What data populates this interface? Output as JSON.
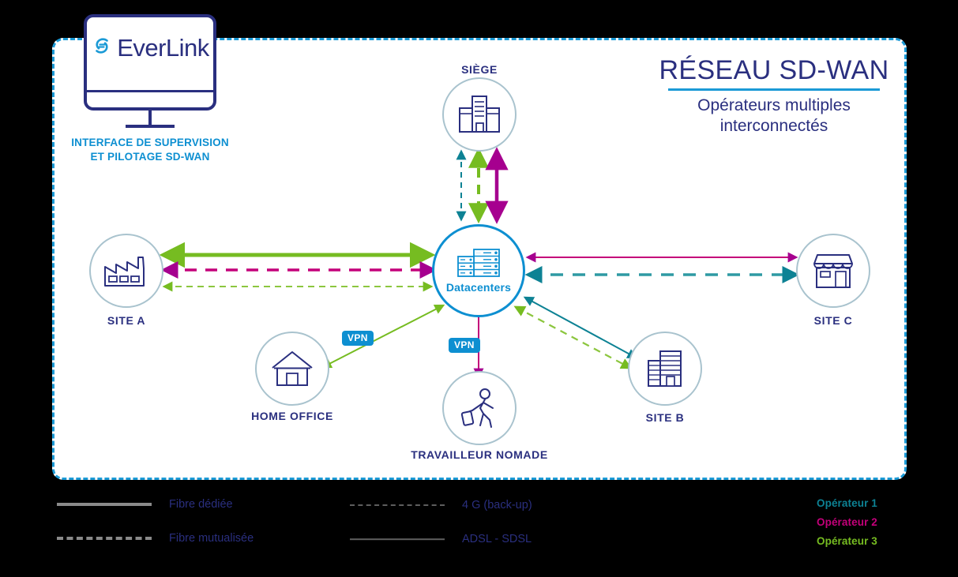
{
  "brand": {
    "logo_text": "EverLink",
    "logo_mark": "everlink-swirl-icon",
    "supervision_label": "INTERFACE DE SUPERVISION\nET PILOTAGE SD-WAN",
    "supervision_line1": "INTERFACE DE SUPERVISION",
    "supervision_line2": "ET PILOTAGE SD-WAN"
  },
  "heading": {
    "title": "RÉSEAU SD-WAN",
    "subtitle_line1": "Opérateurs multiples",
    "subtitle_line2": "interconnectés"
  },
  "nodes": {
    "siege": {
      "label": "SIÈGE",
      "icon": "office-building-icon"
    },
    "datacenters": {
      "label": "Datacenters",
      "icon": "server-rack-icon"
    },
    "site_a": {
      "label": "SITE A",
      "icon": "factory-icon"
    },
    "site_b": {
      "label": "SITE B",
      "icon": "building-icon"
    },
    "site_c": {
      "label": "SITE C",
      "icon": "storefront-icon"
    },
    "home_office": {
      "label": "HOME OFFICE",
      "icon": "house-icon"
    },
    "nomad": {
      "label": "TRAVAILLEUR  NOMADE",
      "icon": "traveler-icon"
    }
  },
  "badges": {
    "vpn_home_office": "VPN",
    "vpn_nomad": "VPN"
  },
  "legend": {
    "items": [
      {
        "label": "Fibre dédiée",
        "style": "solid-thick"
      },
      {
        "label": "Fibre mutualisée",
        "style": "dash-thick"
      },
      {
        "label": "4 G (back-up)",
        "style": "dash-thin"
      },
      {
        "label": "ADSL - SDSL",
        "style": "solid-thin"
      }
    ]
  },
  "operators": [
    {
      "label": "Opérateur 1",
      "color": "#0d8294"
    },
    {
      "label": "Opérateur 2",
      "color": "#c4007a"
    },
    {
      "label": "Opérateur 3",
      "color": "#76bc21"
    }
  ],
  "colors": {
    "operator_1": "#0d8294",
    "operator_2": "#c4007a",
    "operator_3": "#76bc21",
    "navy": "#2a2f7f",
    "brand_blue": "#0d8fd1",
    "frame_blue": "#1b9ad6",
    "node_ring": "#a9c3ce"
  }
}
